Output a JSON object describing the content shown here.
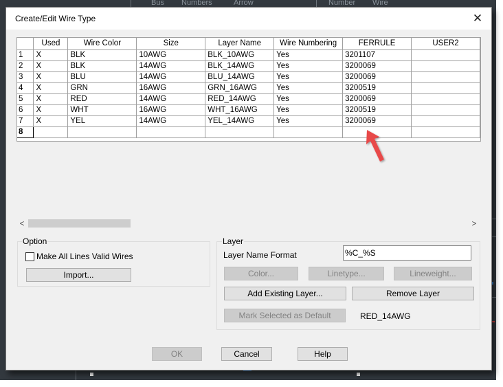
{
  "background": {
    "headers": [
      "Bus",
      "Numbers",
      "Arrow",
      "Number",
      "Wire"
    ]
  },
  "dialog": {
    "title": "Create/Edit Wire Type",
    "close_icon": "close-icon"
  },
  "grid": {
    "columns": [
      "",
      "Used",
      "Wire Color",
      "Size",
      "Layer Name",
      "Wire Numbering",
      "FERRULE",
      "USER2"
    ],
    "rows": [
      {
        "num": "1",
        "used": "X",
        "color": "BLK",
        "size": "10AWG",
        "layer": "BLK_10AWG",
        "numbering": "Yes",
        "ferrule": "3201107",
        "user2": ""
      },
      {
        "num": "2",
        "used": "X",
        "color": "BLK",
        "size": "14AWG",
        "layer": "BLK_14AWG",
        "numbering": "Yes",
        "ferrule": "3200069",
        "user2": ""
      },
      {
        "num": "3",
        "used": "X",
        "color": "BLU",
        "size": "14AWG",
        "layer": "BLU_14AWG",
        "numbering": "Yes",
        "ferrule": "3200069",
        "user2": ""
      },
      {
        "num": "4",
        "used": "X",
        "color": "GRN",
        "size": "16AWG",
        "layer": "GRN_16AWG",
        "numbering": "Yes",
        "ferrule": "3200519",
        "user2": ""
      },
      {
        "num": "5",
        "used": "X",
        "color": "RED",
        "size": "14AWG",
        "layer": "RED_14AWG",
        "numbering": "Yes",
        "ferrule": "3200069",
        "user2": ""
      },
      {
        "num": "6",
        "used": "X",
        "color": "WHT",
        "size": "16AWG",
        "layer": "WHT_16AWG",
        "numbering": "Yes",
        "ferrule": "3200519",
        "user2": ""
      },
      {
        "num": "7",
        "used": "X",
        "color": "YEL",
        "size": "14AWG",
        "layer": "YEL_14AWG",
        "numbering": "Yes",
        "ferrule": "3200069",
        "user2": ""
      },
      {
        "num": "8",
        "used": "",
        "color": "",
        "size": "",
        "layer": "",
        "numbering": "",
        "ferrule": "",
        "user2": ""
      }
    ]
  },
  "scrollbar": {
    "left_arrow": "<",
    "right_arrow": ">"
  },
  "option": {
    "title": "Option",
    "make_all_lines_label": "Make All Lines Valid Wires",
    "make_all_lines_checked": false,
    "import_label": "Import..."
  },
  "layer": {
    "title": "Layer",
    "name_format_label": "Layer Name Format",
    "name_format_value": "%C_%S",
    "color_label": "Color...",
    "linetype_label": "Linetype...",
    "lineweight_label": "Lineweight...",
    "add_existing_label": "Add Existing Layer...",
    "remove_label": "Remove Layer",
    "mark_default_label": "Mark Selected as Default",
    "default_value": "RED_14AWG"
  },
  "footer": {
    "ok_label": "OK",
    "cancel_label": "Cancel",
    "help_label": "Help"
  },
  "colors": {
    "annotation_arrow": "#e84848",
    "background": "#33393f"
  }
}
